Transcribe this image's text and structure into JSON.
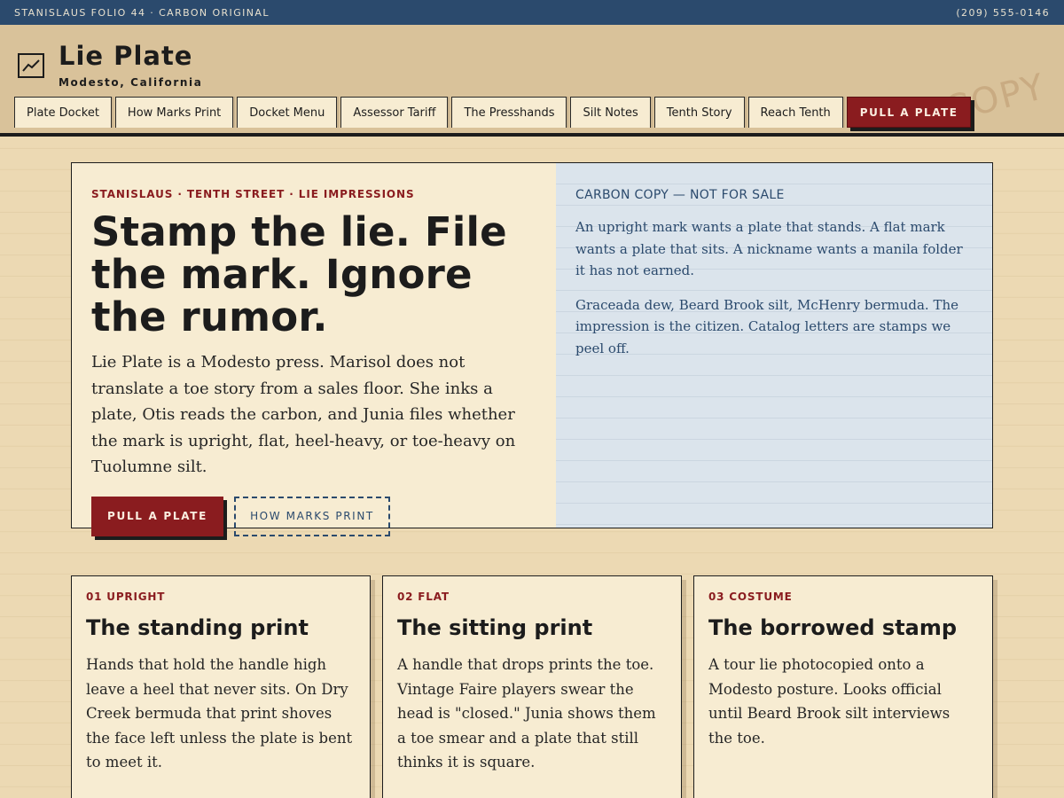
{
  "topbar": {
    "left": "STANISLAUS FOLIO 44 · CARBON ORIGINAL",
    "right": "(209) 555-0146"
  },
  "brand": {
    "icon": "chart-line-icon",
    "title": "Lie Plate",
    "subtitle": "Modesto, California",
    "stamp": "COPY"
  },
  "nav": {
    "items": [
      {
        "label": "Plate Docket"
      },
      {
        "label": "How Marks Print"
      },
      {
        "label": "Docket Menu"
      },
      {
        "label": "Assessor Tariff"
      },
      {
        "label": "The Presshands"
      },
      {
        "label": "Silt Notes"
      },
      {
        "label": "Tenth Story"
      },
      {
        "label": "Reach Tenth"
      }
    ],
    "cta": "PULL A PLATE"
  },
  "hero": {
    "kicker": "STANISLAUS · TENTH STREET · LIE IMPRESSIONS",
    "headline": "Stamp the lie. File the mark. Ignore the rumor.",
    "lede": "Lie Plate is a Modesto press. Marisol does not translate a toe story from a sales floor. She inks a plate, Otis reads the carbon, and Junia files whether the mark is upright, flat, heel-heavy, or toe-heavy on Tuolumne silt.",
    "primary_button": "PULL A PLATE",
    "secondary_button": "HOW MARKS PRINT"
  },
  "carbon": {
    "label": "CARBON COPY — NOT FOR SALE",
    "paragraphs": [
      "An upright mark wants a plate that stands. A flat mark wants a plate that sits. A nickname wants a manila folder it has not earned.",
      "Graceada dew, Beard Brook silt, McHenry bermuda. The impression is the citizen. Catalog letters are stamps we peel off."
    ]
  },
  "cards": [
    {
      "num": "01 UPRIGHT",
      "title": "The standing print",
      "body": "Hands that hold the handle high leave a heel that never sits. On Dry Creek bermuda that print shoves the face left unless the plate is bent to meet it."
    },
    {
      "num": "02 FLAT",
      "title": "The sitting print",
      "body": "A handle that drops prints the toe. Vintage Faire players swear the head is \"closed.\" Junia shows them a toe smear and a plate that still thinks it is square."
    },
    {
      "num": "03 COSTUME",
      "title": "The borrowed stamp",
      "body": "A tour lie photocopied onto a Modesto posture. Looks official until Beard Brook silt interviews the toe."
    }
  ],
  "colors": {
    "accent_red": "#8a1c1f",
    "ink_blue": "#2b4a6d",
    "paper": "#f7ecd2",
    "carbon_blue": "#dbe4ec",
    "background": "#ecd9b3"
  }
}
